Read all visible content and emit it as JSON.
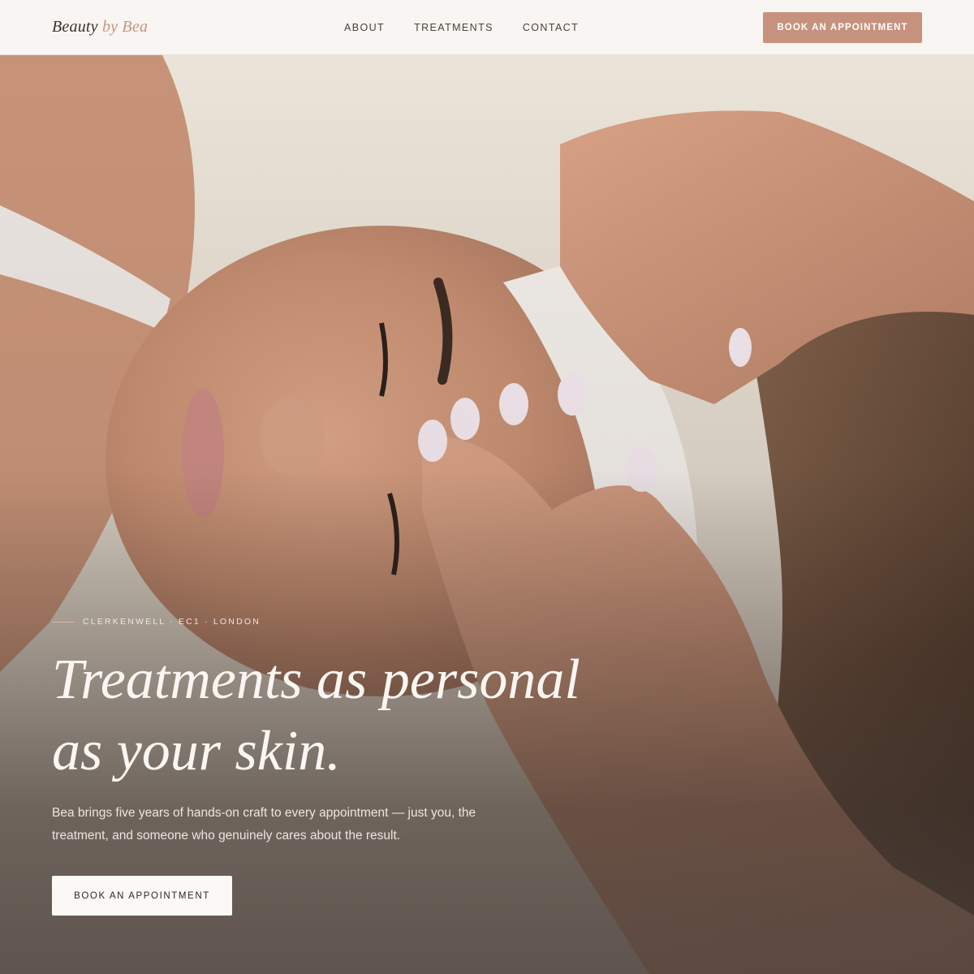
{
  "brand": {
    "name_part1": "Beauty",
    "name_part2": "by Bea"
  },
  "nav": {
    "links": [
      "ABOUT",
      "TREATMENTS",
      "CONTACT"
    ],
    "cta_label": "BOOK AN APPOINTMENT"
  },
  "hero": {
    "eyebrow": "CLERKENWELL · EC1 · LONDON",
    "headline_line1": "Treatments as personal",
    "headline_line2": "as your skin.",
    "subcopy": "Bea brings five years of hands-on craft to every appointment — just you, the treatment, and someone who genuinely cares about the result.",
    "cta_label": "BOOK AN APPOINTMENT"
  },
  "colors": {
    "accent": "#c6927d",
    "nav_bg": "#f8f5f2",
    "text_dark": "#3a302b",
    "hero_text": "#fbf6f2"
  }
}
